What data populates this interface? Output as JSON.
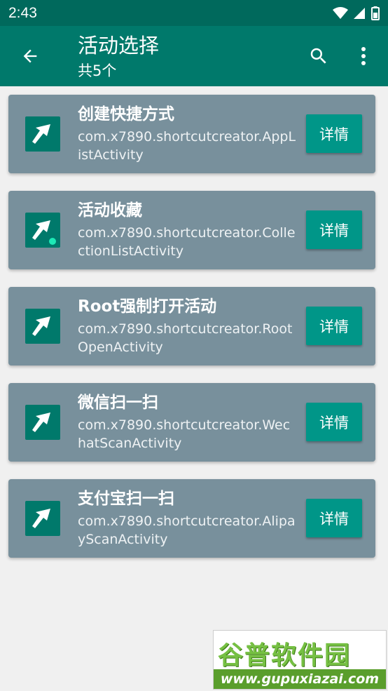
{
  "status_bar": {
    "time": "2:43"
  },
  "app_bar": {
    "title": "活动选择",
    "subtitle": "共5个"
  },
  "items": [
    {
      "name": "创建快捷方式",
      "class_name": "com.x7890.shortcutcreator.AppListActivity",
      "button": "详情"
    },
    {
      "name": "活动收藏",
      "class_name": "com.x7890.shortcutcreator.CollectionListActivity",
      "button": "详情"
    },
    {
      "name": "Root强制打开活动",
      "class_name": "com.x7890.shortcutcreator.RootOpenActivity",
      "button": "详情"
    },
    {
      "name": "微信扫一扫",
      "class_name": "com.x7890.shortcutcreator.WechatScanActivity",
      "button": "详情"
    },
    {
      "name": "支付宝扫一扫",
      "class_name": "com.x7890.shortcutcreator.AlipayScanActivity",
      "button": "详情"
    }
  ],
  "watermark": {
    "logo": "谷普软件园",
    "url": "www.gupuxiazai.com"
  },
  "colors": {
    "status_bar": "#00695c",
    "app_bar": "#00796b",
    "card": "#78909c",
    "button": "#009688",
    "background": "#f0f0f0"
  }
}
